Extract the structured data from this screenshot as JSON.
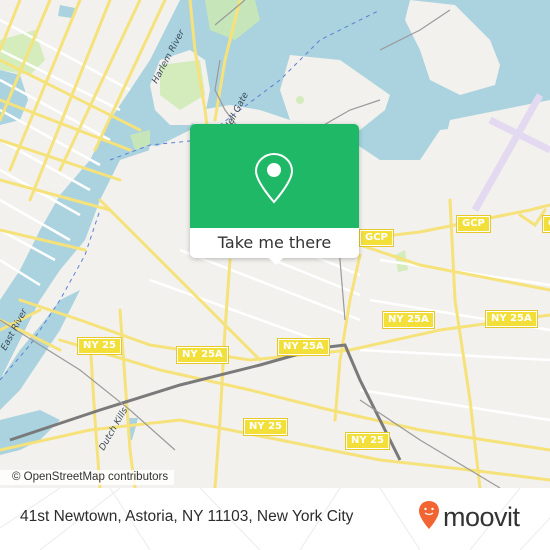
{
  "map": {
    "attribution": "© OpenStreetMap contributors",
    "colors": {
      "land": "#f2f1ed",
      "water": "#aad3df",
      "road_major": "#f6e27a",
      "park": "#cdebb0",
      "airport": "#e9e2f2",
      "rail": "#777777"
    },
    "water_labels": [
      {
        "text": "Harlem River"
      },
      {
        "text": "Hell Gate"
      },
      {
        "text": "East River"
      },
      {
        "text": "Dutch Kills"
      }
    ],
    "shields": [
      {
        "text": "GCP"
      },
      {
        "text": "GCP"
      },
      {
        "text": "G"
      },
      {
        "text": "NY 25A"
      },
      {
        "text": "NY 25A"
      },
      {
        "text": "NY 25A"
      },
      {
        "text": "NY 25A"
      },
      {
        "text": "NY 25"
      },
      {
        "text": "NY 25"
      },
      {
        "text": "NY 25"
      }
    ]
  },
  "popup": {
    "icon": "location-pin-icon",
    "button_label": "Take me there",
    "color": "#1fb866"
  },
  "footer": {
    "address": "41st Newtown, Astoria, NY 11103, New York City",
    "brand": "moovit",
    "brand_color": "#f26532"
  }
}
